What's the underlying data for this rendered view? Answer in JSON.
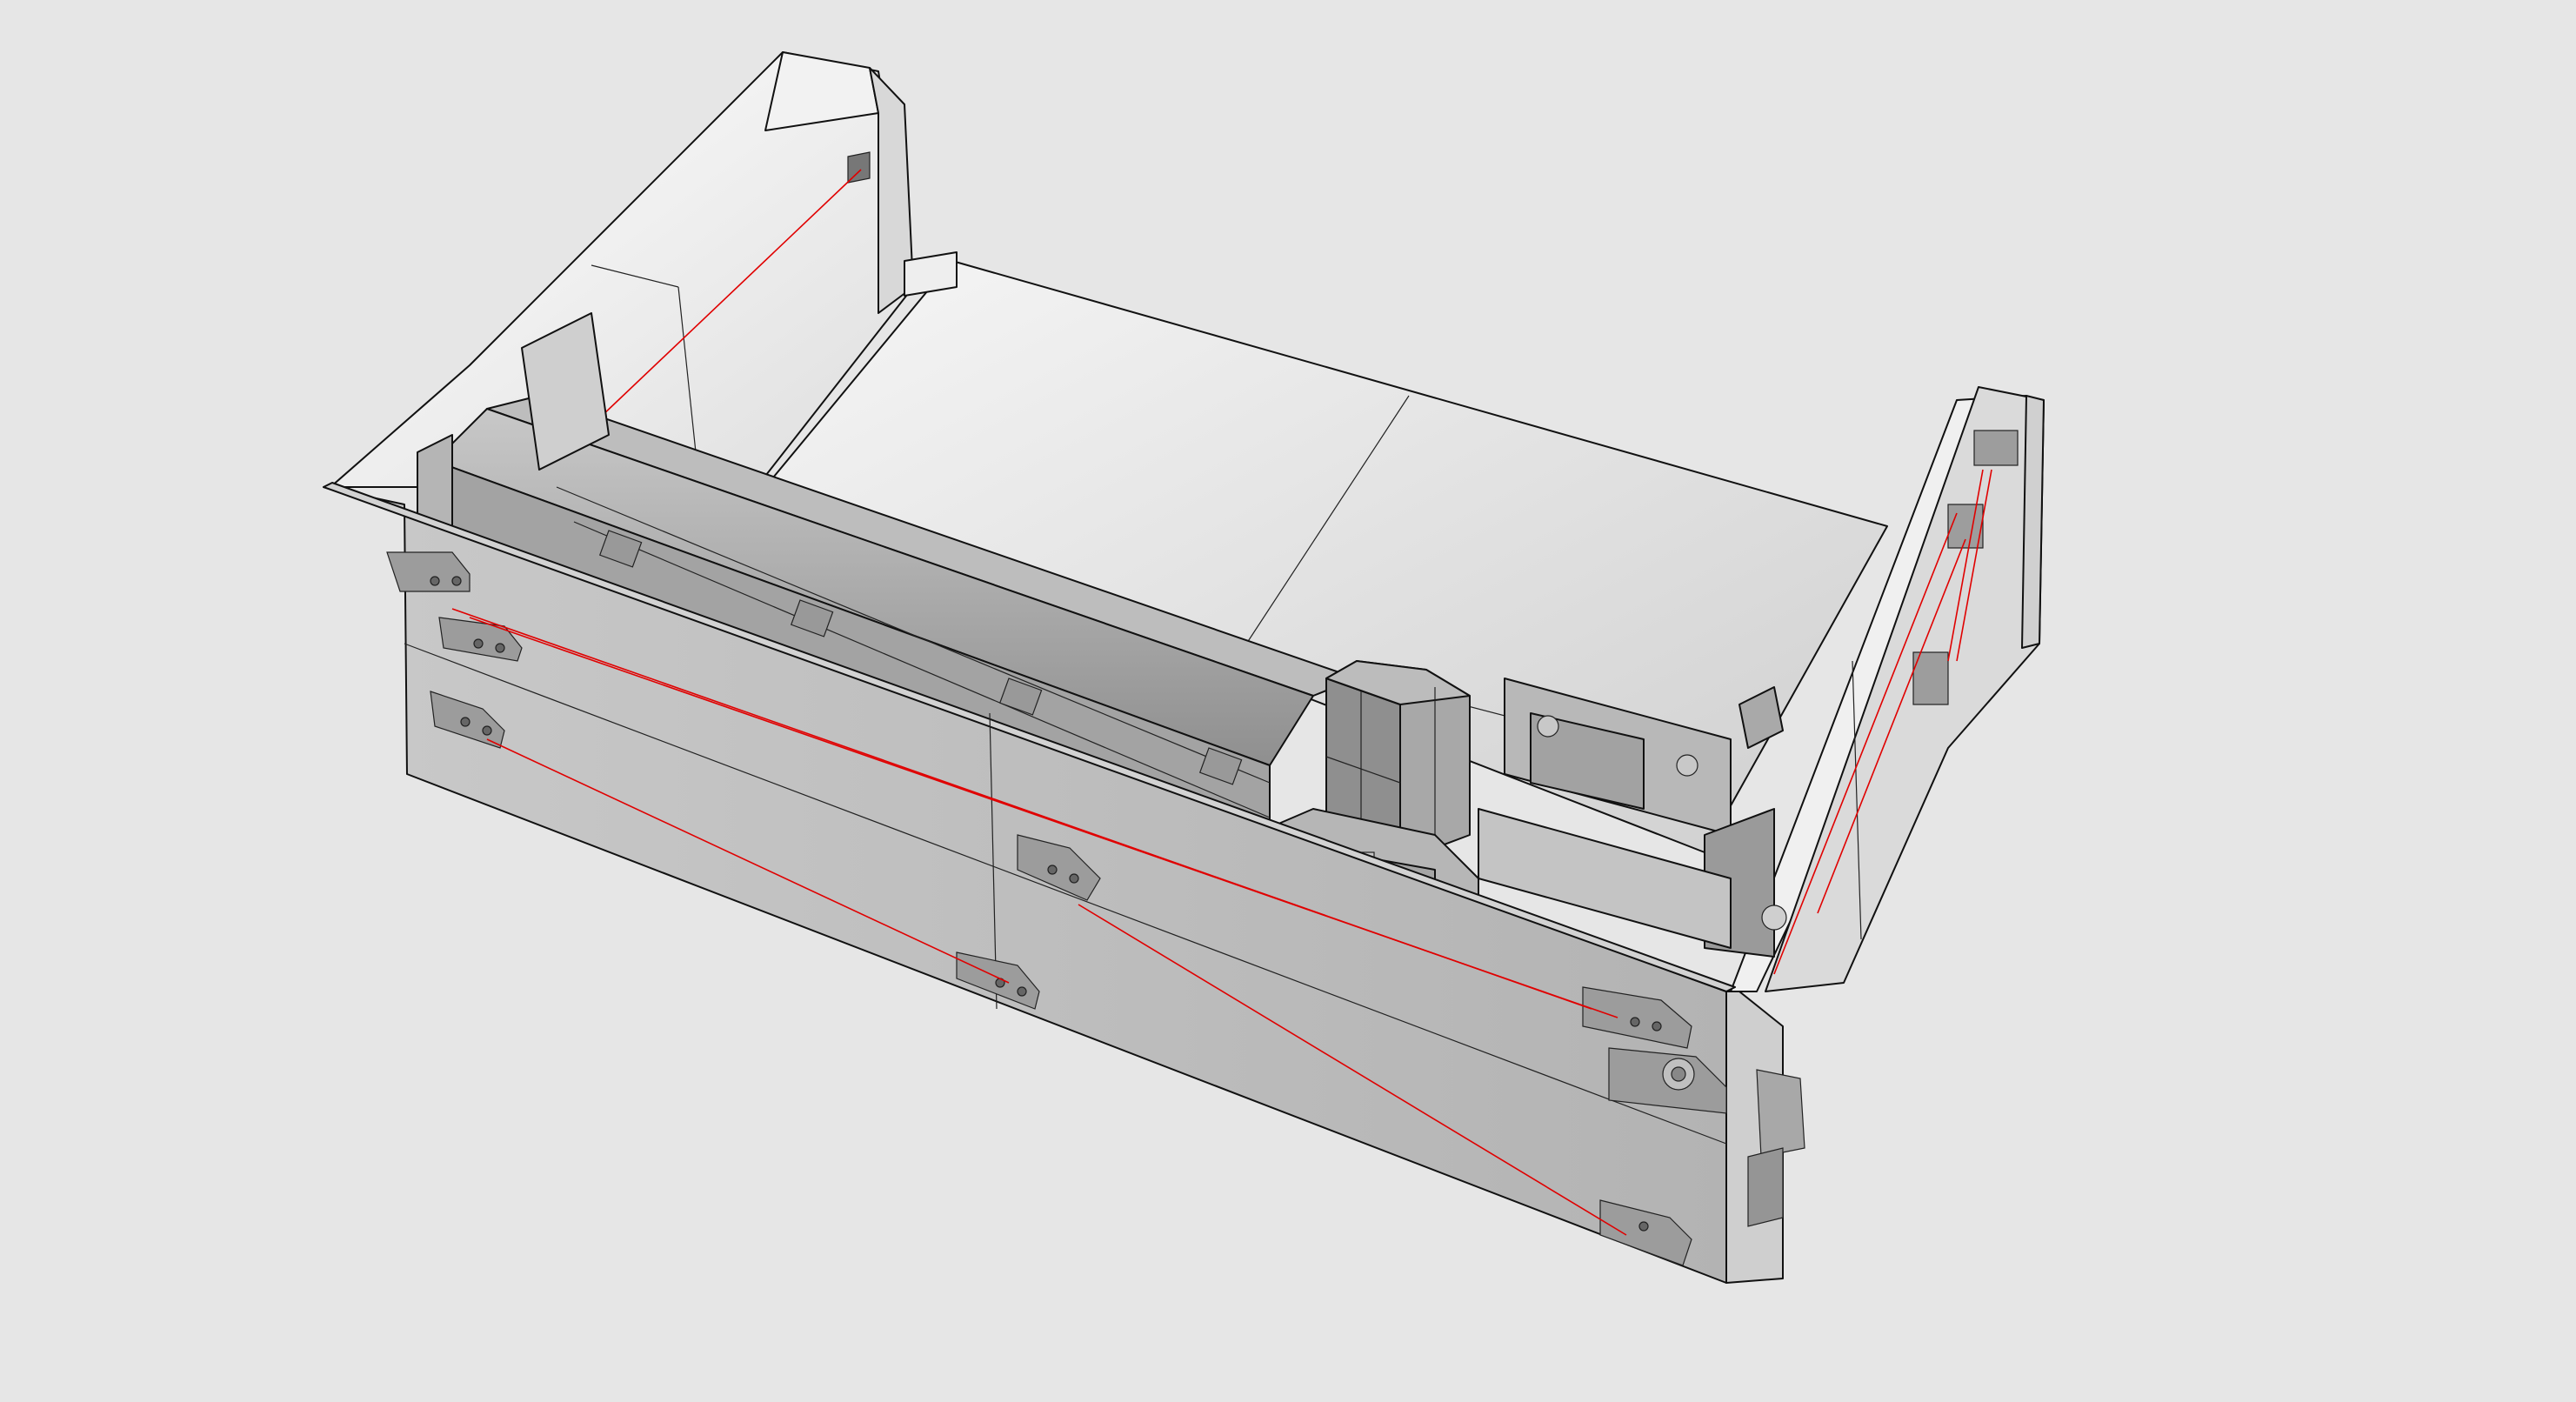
{
  "viewport": {
    "background": "#e6e6e6",
    "render_style": "shaded-with-edges",
    "accent_color": "#e00000"
  },
  "model": {
    "parts": [
      "left-side-panel",
      "floor-panel",
      "back-wall",
      "front-panel",
      "right-side-panel",
      "gantry-rail",
      "carriage-block",
      "motor-mount",
      "pulley-block"
    ],
    "belt_color": "#e00000"
  }
}
